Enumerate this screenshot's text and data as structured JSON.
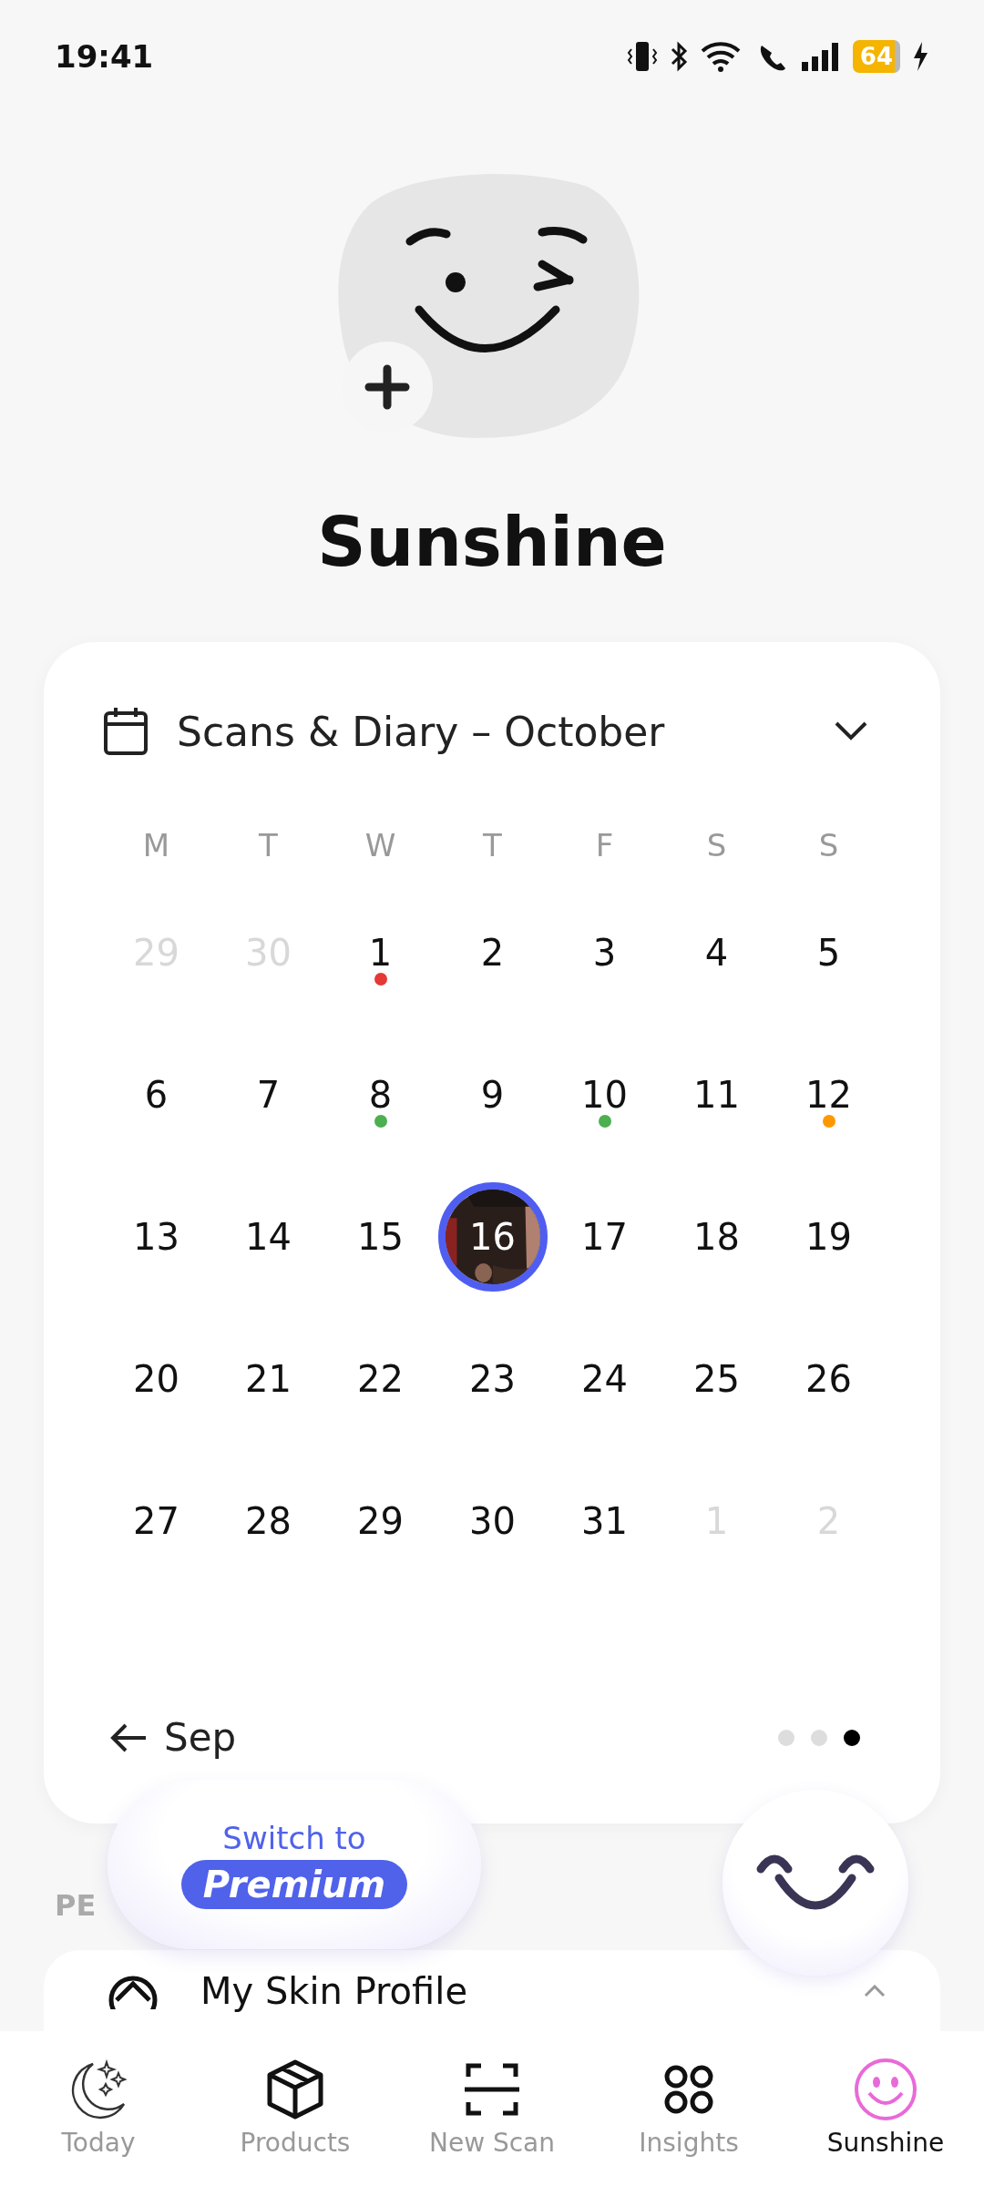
{
  "status_bar": {
    "time": "19:41",
    "battery": "64"
  },
  "profile": {
    "name": "Sunshine"
  },
  "calendar": {
    "title": "Scans & Diary – October",
    "weekdays": [
      "M",
      "T",
      "W",
      "T",
      "F",
      "S",
      "S"
    ],
    "days": [
      {
        "label": "29",
        "kind": "other",
        "selected": false
      },
      {
        "label": "30",
        "kind": "other",
        "selected": false
      },
      {
        "label": "1",
        "kind": "day",
        "selected": false,
        "color": "#e53935"
      },
      {
        "label": "2",
        "kind": "day",
        "selected": false
      },
      {
        "label": "3",
        "kind": "day",
        "selected": false
      },
      {
        "label": "4",
        "kind": "day",
        "selected": false
      },
      {
        "label": "5",
        "kind": "day",
        "selected": false
      },
      {
        "label": "6",
        "kind": "day",
        "selected": false
      },
      {
        "label": "7",
        "kind": "day",
        "selected": false
      },
      {
        "label": "8",
        "kind": "day",
        "selected": false,
        "color": "#4caf50"
      },
      {
        "label": "9",
        "kind": "day",
        "selected": false
      },
      {
        "label": "10",
        "kind": "day",
        "selected": false,
        "color": "#4caf50"
      },
      {
        "label": "11",
        "kind": "day",
        "selected": false
      },
      {
        "label": "12",
        "kind": "day",
        "selected": false,
        "color": "#ff9800"
      },
      {
        "label": "13",
        "kind": "day",
        "selected": false
      },
      {
        "label": "14",
        "kind": "day",
        "selected": false
      },
      {
        "label": "15",
        "kind": "day",
        "selected": false
      },
      {
        "label": "16",
        "selected": true
      },
      {
        "label": "17",
        "kind": "day",
        "selected": false
      },
      {
        "label": "18",
        "kind": "day",
        "selected": false
      },
      {
        "label": "19",
        "kind": "day",
        "selected": false
      },
      {
        "label": "20",
        "kind": "day",
        "selected": false
      },
      {
        "label": "21",
        "kind": "day",
        "selected": false
      },
      {
        "label": "22",
        "kind": "day",
        "selected": false
      },
      {
        "label": "23",
        "kind": "day",
        "selected": false
      },
      {
        "label": "24",
        "kind": "day",
        "selected": false
      },
      {
        "label": "25",
        "kind": "day",
        "selected": false
      },
      {
        "label": "26",
        "kind": "day",
        "selected": false
      },
      {
        "label": "27",
        "kind": "day",
        "selected": false
      },
      {
        "label": "28",
        "kind": "day",
        "selected": false
      },
      {
        "label": "29",
        "kind": "day",
        "selected": false
      },
      {
        "label": "30",
        "kind": "day",
        "selected": false
      },
      {
        "label": "31",
        "kind": "day",
        "selected": false
      },
      {
        "label": "1",
        "kind": "other",
        "selected": false
      },
      {
        "label": "2",
        "kind": "other",
        "selected": false
      }
    ],
    "prev_label": "Sep",
    "pages": [
      {
        "selected": false
      },
      {
        "selected": false
      },
      {
        "selected": true
      }
    ]
  },
  "premium": {
    "line1": "Switch to",
    "line2": "Premium"
  },
  "section_label": "PE",
  "profile_row": {
    "label": "My Skin Profile"
  },
  "nav": [
    {
      "label": "Today",
      "selected": false
    },
    {
      "label": "Products",
      "selected": false
    },
    {
      "label": "New Scan",
      "selected": false
    },
    {
      "label": "Insights",
      "selected": false
    },
    {
      "label": "Sunshine",
      "selected": true
    }
  ]
}
